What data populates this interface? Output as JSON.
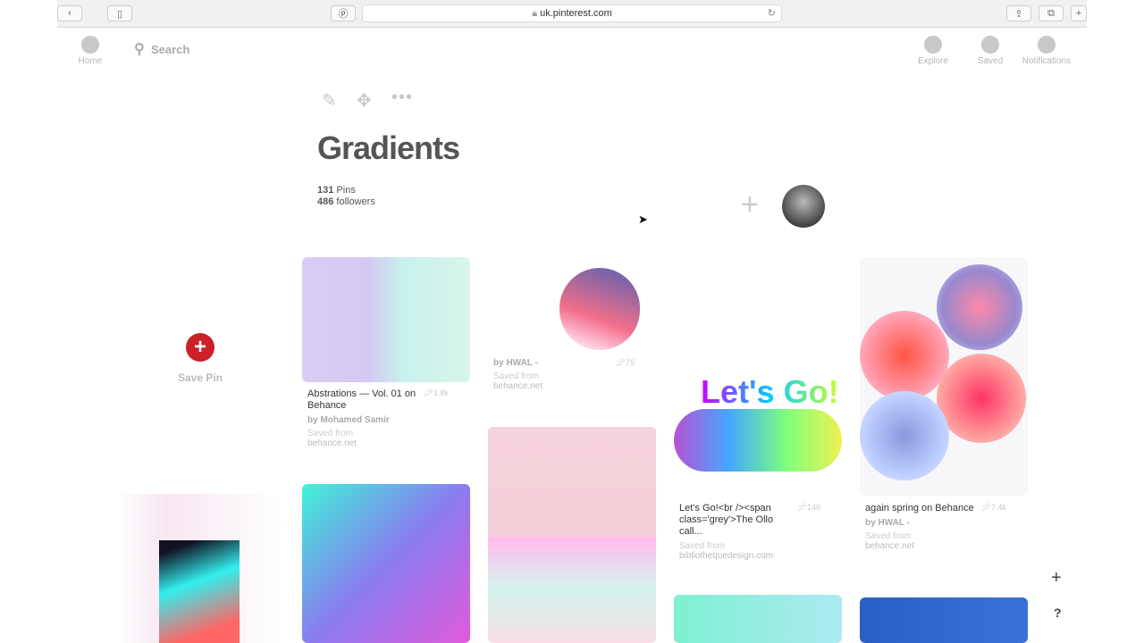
{
  "browser": {
    "url": "uk.pinterest.com"
  },
  "nav": {
    "home": "Home",
    "search": "Search",
    "explore": "Explore",
    "saved": "Saved",
    "notifications": "Notifications"
  },
  "board": {
    "title": "Gradients",
    "pins_count": "131",
    "pins_label": "Pins",
    "followers_count": "486",
    "followers_label": "followers"
  },
  "save_pin": "Save Pin",
  "pins": [
    {
      "title": "Abstrations — Vol. 01 on Behance",
      "by": "by Mohamed Samir",
      "saved_from": "Saved from",
      "source": "behance.net",
      "count": "1.8k"
    },
    {
      "title": "",
      "by": "by HWAL -",
      "saved_from": "Saved from",
      "source": "behance.net",
      "count": "75"
    },
    {
      "title": "Let's Go!<br /><span class='grey'>The Ollo call...",
      "by": "",
      "saved_from": "Saved from",
      "source": "bibliothequedesign.com",
      "count": "146",
      "image_text": "Let's Go!"
    },
    {
      "title": "again spring on Behance",
      "by": "by HWAL -",
      "saved_from": "Saved from",
      "source": "behance.net",
      "count": "7.4k"
    }
  ],
  "colors": {
    "brand": "#cb2027"
  },
  "fab": {
    "plus": "+",
    "help": "?"
  }
}
